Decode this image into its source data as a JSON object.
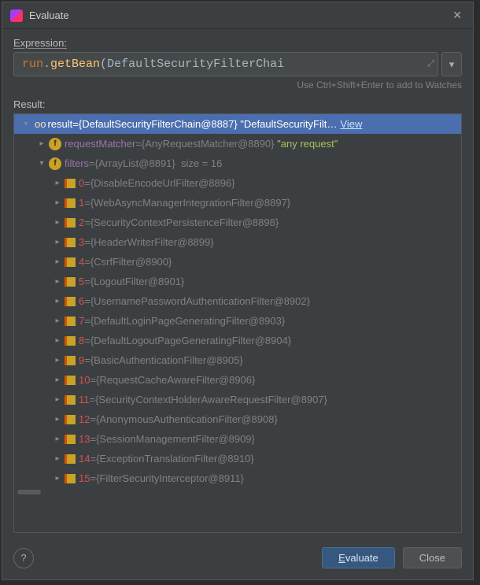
{
  "window": {
    "title": "Evaluate"
  },
  "labels": {
    "expression": "Expression:",
    "result": "Result:",
    "hint": "Use Ctrl+Shift+Enter to add to Watches"
  },
  "expression": {
    "var": "run",
    "dot": ".",
    "bean": "getBean",
    "paren_o": "(",
    "cls": "DefaultSecurityFilterChai",
    "expand_icon": "⤢"
  },
  "root": {
    "name": "result",
    "value": "{DefaultSecurityFilterChain@8887}",
    "text": "\"DefaultSecurityFilt…",
    "view": "View"
  },
  "requestMatcher": {
    "name": "requestMatcher",
    "value": "{AnyRequestMatcher@8890}",
    "text": "\"any request\""
  },
  "filters": {
    "name": "filters",
    "value": "{ArrayList@8891}",
    "size": "size = 16",
    "items": [
      {
        "idx": "0",
        "value": "{DisableEncodeUrlFilter@8896}"
      },
      {
        "idx": "1",
        "value": "{WebAsyncManagerIntegrationFilter@8897}"
      },
      {
        "idx": "2",
        "value": "{SecurityContextPersistenceFilter@8898}"
      },
      {
        "idx": "3",
        "value": "{HeaderWriterFilter@8899}"
      },
      {
        "idx": "4",
        "value": "{CsrfFilter@8900}"
      },
      {
        "idx": "5",
        "value": "{LogoutFilter@8901}"
      },
      {
        "idx": "6",
        "value": "{UsernamePasswordAuthenticationFilter@8902}"
      },
      {
        "idx": "7",
        "value": "{DefaultLoginPageGeneratingFilter@8903}"
      },
      {
        "idx": "8",
        "value": "{DefaultLogoutPageGeneratingFilter@8904}"
      },
      {
        "idx": "9",
        "value": "{BasicAuthenticationFilter@8905}"
      },
      {
        "idx": "10",
        "value": "{RequestCacheAwareFilter@8906}"
      },
      {
        "idx": "11",
        "value": "{SecurityContextHolderAwareRequestFilter@8907}"
      },
      {
        "idx": "12",
        "value": "{AnonymousAuthenticationFilter@8908}"
      },
      {
        "idx": "13",
        "value": "{SessionManagementFilter@8909}"
      },
      {
        "idx": "14",
        "value": "{ExceptionTranslationFilter@8910}"
      },
      {
        "idx": "15",
        "value": "{FilterSecurityInterceptor@8911}"
      }
    ]
  },
  "buttons": {
    "help": "?",
    "evaluate_pre": "E",
    "evaluate_rest": "valuate",
    "close": "Close"
  },
  "glyphs": {
    "eq": " = ",
    "f": "f",
    "glasses": "oo",
    "dropdown": "▾"
  }
}
